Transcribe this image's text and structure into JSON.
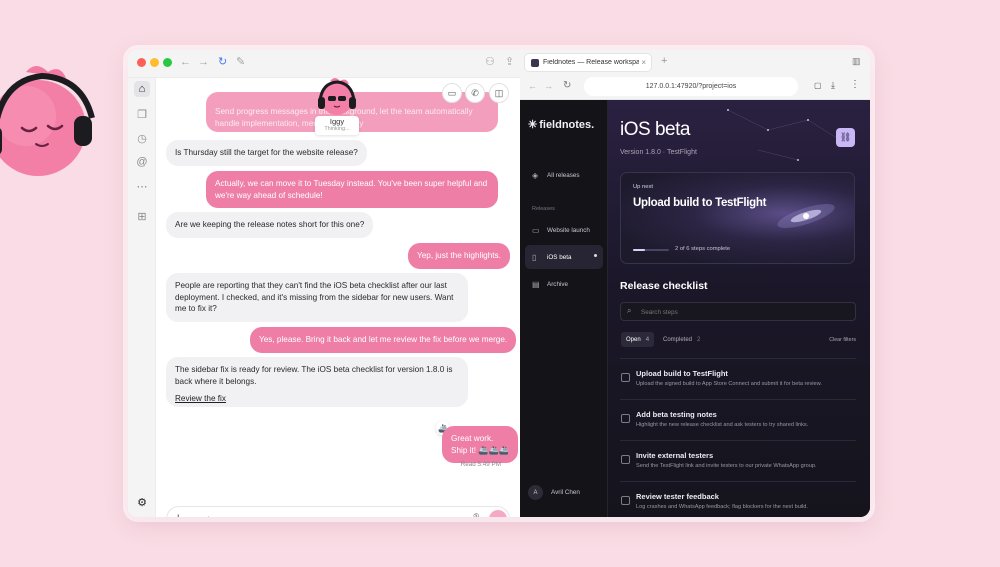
{
  "chat": {
    "preview_text": "Send progress messages in the background, let the team automatically handle implementation, merge, or deploy",
    "agent_name": "Iggy",
    "agent_status": "Thinking...",
    "messages": [
      {
        "from": "user",
        "text": "Is Thursday still the target for the website release?"
      },
      {
        "from": "agent",
        "text": "Actually, we can move it to Tuesday instead. You've been super helpful and we're way ahead of schedule!"
      },
      {
        "from": "user",
        "text": "Are we keeping the release notes short for this one?"
      },
      {
        "from": "agent",
        "text": "Yep, just the highlights."
      },
      {
        "from": "user",
        "text": "People are reporting that they can't find the iOS beta checklist after our last deployment. I checked, and it's missing from the sidebar for new users. Want me to fix it?"
      },
      {
        "from": "agent",
        "text": "Yes, please. Bring it back and let me review the fix before we merge."
      },
      {
        "from": "user",
        "text": "The sidebar fix is ready for review. The iOS beta checklist for version 1.8.0 is back where it belongs.",
        "link": "Review the fix"
      },
      {
        "from": "agent",
        "text": "Great work.",
        "text2": "Ship it! 🚢🚢🚢"
      }
    ],
    "read_receipt": "Read 5:49 PM",
    "input_placeholder": "Send a message"
  },
  "browser": {
    "tab_title": "Fieldnotes — Release workspace",
    "url": "127.0.0.1:47920/?project=ios"
  },
  "app": {
    "brand": "fieldnotes.",
    "nav": {
      "all_releases": "All releases",
      "section_label": "Releases",
      "items": [
        "Website launch",
        "iOS beta",
        "Archive"
      ]
    },
    "user_initial": "A",
    "user_name": "Avril Chen"
  },
  "release": {
    "title": "iOS beta",
    "subtitle": "Version 1.8.0 · TestFlight",
    "up_next_label": "Up next",
    "up_next_title": "Upload build to TestFlight",
    "progress_text": "2 of 6 steps complete",
    "progress_fraction": 0.33
  },
  "checklist": {
    "heading": "Release checklist",
    "search_placeholder": "Search steps",
    "tabs": [
      {
        "label": "Open",
        "count": "4"
      },
      {
        "label": "Completed",
        "count": "2"
      }
    ],
    "clear_filters": "Clear filters",
    "items": [
      {
        "title": "Upload build to TestFlight",
        "desc": "Upload the signed build to App Store Connect and submit it for beta review."
      },
      {
        "title": "Add beta testing notes",
        "desc": "Highlight the new release checklist and ask testers to try shared links."
      },
      {
        "title": "Invite external testers",
        "desc": "Send the TestFlight link and invite testers to our private WhatsApp group."
      },
      {
        "title": "Review tester feedback",
        "desc": "Log crashes and WhatsApp feedback; flag blockers for the next build."
      }
    ]
  },
  "colors": {
    "accent_pink": "#ee7ea6",
    "dark_bg": "#14131b",
    "lavender_button": "#c9b8f5"
  }
}
